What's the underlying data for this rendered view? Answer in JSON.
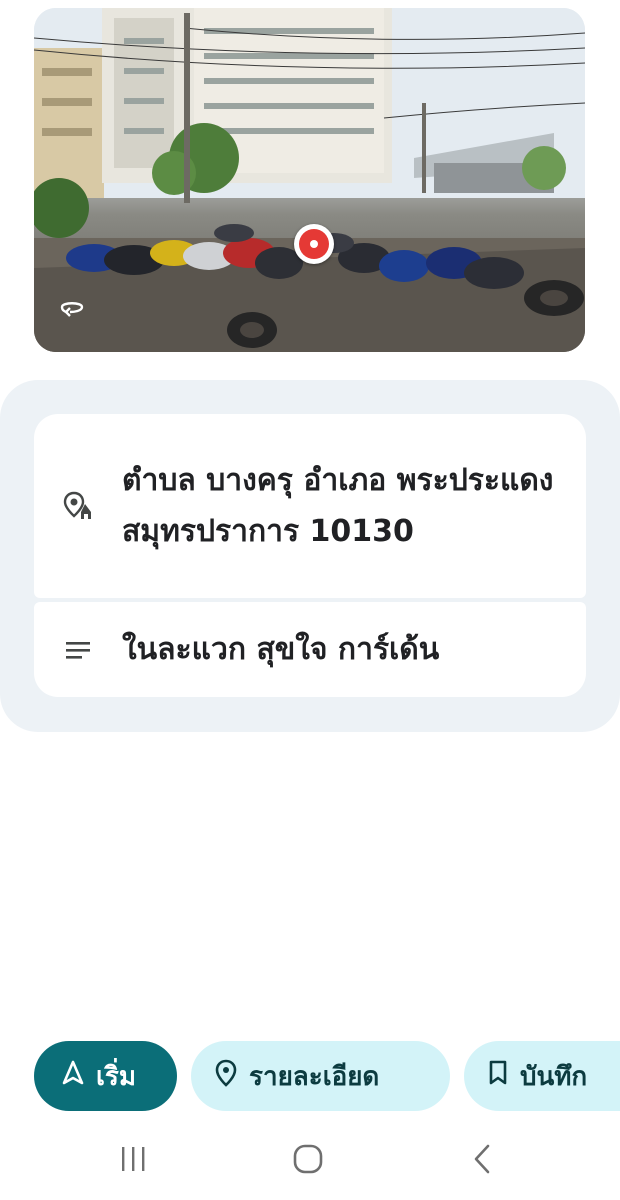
{
  "street_view": {
    "rotate_icon": "rotate-360-icon",
    "marker_icon": "location-marker-icon"
  },
  "place": {
    "address_icon": "address-pin-icon",
    "address": "ตำบล บางครุ อำเภอ พระประแดง สมุทรปราการ 10130",
    "plus_code_icon": "notes-lines-icon",
    "plus_code": "ในละแวก สุขใจ การ์เด้น"
  },
  "actions": {
    "start_label": "เริ่ม",
    "start_icon": "navigation-arrow-icon",
    "details_label": "รายละเอียด",
    "details_icon": "location-pin-icon",
    "save_label": "บันทึก",
    "save_icon": "bookmark-icon"
  },
  "navbar": {
    "recents_icon": "recents-icon",
    "home_icon": "home-icon",
    "back_icon": "back-icon"
  },
  "colors": {
    "primary": "#0b6e78",
    "chip_bg": "#d3f3f8",
    "panel_bg": "#edf2f6",
    "marker_red": "#e53935"
  }
}
